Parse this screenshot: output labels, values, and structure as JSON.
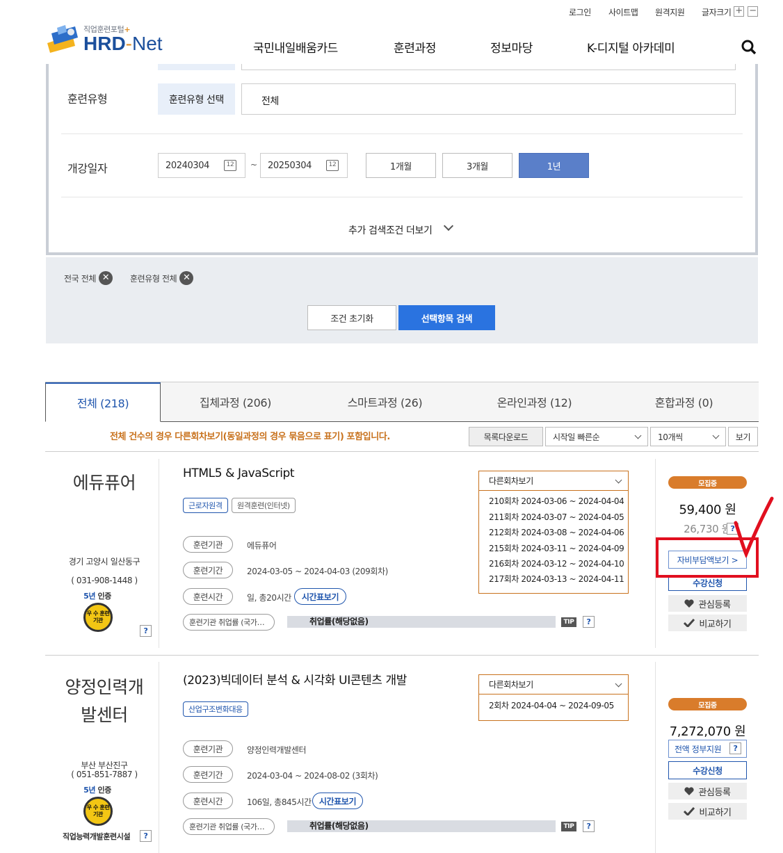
{
  "util": {
    "login": "로그인",
    "sitemap": "사이트맵",
    "remote": "원격지원",
    "fontsize": "글자크기",
    "plus": "+",
    "minus": "−"
  },
  "logo": {
    "subtitle": "직업훈련포털",
    "plus": "+",
    "hrd": "HRD",
    "dash": "-",
    "net": "Net"
  },
  "gnb": [
    "국민내일배움카드",
    "훈련과정",
    "정보마당",
    "K-디지털 아카데미"
  ],
  "search": {
    "type_label": "훈련유형",
    "type_btn": "훈련유형 선택",
    "type_value": "전체",
    "date_label": "개강일자",
    "date_from": "20240304",
    "date_to": "20250304",
    "tilde": "~",
    "cal_icon": "12",
    "periods": [
      "1개월",
      "3개월",
      "1년"
    ],
    "active_period": "1년",
    "more": "추가 검색조건 더보기"
  },
  "filters": {
    "chips": [
      "전국 전체",
      "훈련유형 전체"
    ],
    "reset": "조건 초기화",
    "submit": "선택항목 검색"
  },
  "tabs": [
    "전체 (218)",
    "집체과정 (206)",
    "스마트과정 (26)",
    "온라인과정 (12)",
    "혼합과정 (0)"
  ],
  "list_notice": "전체 건수의 경우 다른회차보기(동일과정의 경우 묶음으로 표기) 포함입니다.",
  "controls": {
    "download": "목록다운로드",
    "sort": "시작일 빠른순",
    "count": "10개씩",
    "view": "보기"
  },
  "common": {
    "org_label": "훈련기관",
    "period_label": "훈련기간",
    "time_label": "훈련시간",
    "timetable": "시간표보기",
    "emp_label": "훈련기관 취업률 (국가…",
    "emp_value": "취업률(해당없음)",
    "tip": "TIP",
    "other_label": "다른회차보기",
    "recruiting": "모집중",
    "interest": "관심등록",
    "compare": "비교하기",
    "apply": "수강신청",
    "cert_years": "5년",
    "cert_text": " 인증",
    "medal": "우 수 훈련기관",
    "q": "?"
  },
  "courses": [
    {
      "inst": "에듀퓨어",
      "addr": "경기 고양시 일산동구",
      "phone": "( 031-908-1448 )",
      "title": "HTML5 & JavaScript",
      "tags": [
        "근로자원격",
        "원격훈련(인터넷)"
      ],
      "org": "에듀퓨어",
      "period": "2024-03-05 ~ 2024-04-03 (209회차)",
      "hours": "일, 총20시간",
      "rounds": [
        "210회차 2024-03-06 ~ 2024-04-04",
        "211회차 2024-03-07 ~ 2024-04-05",
        "212회차 2024-03-08 ~ 2024-04-06",
        "215회차 2024-03-11 ~ 2024-04-09",
        "216회차 2024-03-12 ~ 2024-04-10",
        "217회차 2024-03-13 ~ 2024-04-11"
      ],
      "price": "59,400 원",
      "self_price": "26,730 원",
      "self_btn": "자비부담액보기 >"
    },
    {
      "inst": "양정인력개발센터",
      "inst_lines": [
        "양정인력개",
        "발센터"
      ],
      "addr": "부산 부산진구",
      "phone": "( 051-851-7887 )",
      "extra": "직업능력개발훈련시설",
      "title": "(2023)빅데이터 분석 & 시각화 UI콘텐츠 개발",
      "tags": [
        "산업구조변화대응"
      ],
      "org": "양정인력개발센터",
      "period": "2024-03-04 ~ 2024-08-02 (3회차)",
      "hours": "106일, 총845시간",
      "rounds": [
        "2회차 2024-04-04 ~ 2024-09-05"
      ],
      "price": "7,272,070 원",
      "gov_btn": "전액 정부지원"
    }
  ],
  "colors": {
    "accent": "#1f55ad",
    "orange": "#d97c2b",
    "annotation": "#e10f1f"
  }
}
